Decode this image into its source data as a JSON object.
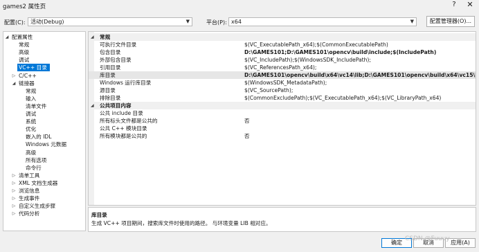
{
  "window": {
    "title": "games2 属性页",
    "help": "?",
    "close": "✕"
  },
  "toolbar": {
    "config_label": "配置(C):",
    "config_value": "活动(Debug)",
    "platform_label": "平台(P):",
    "platform_value": "x64",
    "config_manager": "配置管理器(O)..."
  },
  "tree": [
    {
      "label": "配置属性",
      "exp": "◢",
      "level": 0
    },
    {
      "label": "常规",
      "level": 1
    },
    {
      "label": "高级",
      "level": 1
    },
    {
      "label": "调试",
      "level": 1
    },
    {
      "label": "VC++ 目录",
      "level": 1,
      "selected": true
    },
    {
      "label": "C/C++",
      "exp": "▷",
      "level": 1
    },
    {
      "label": "链接器",
      "exp": "◢",
      "level": 1
    },
    {
      "label": "常规",
      "level": 2
    },
    {
      "label": "输入",
      "level": 2
    },
    {
      "label": "清单文件",
      "level": 2
    },
    {
      "label": "调试",
      "level": 2
    },
    {
      "label": "系统",
      "level": 2
    },
    {
      "label": "优化",
      "level": 2
    },
    {
      "label": "嵌入的 IDL",
      "level": 2
    },
    {
      "label": "Windows 元数据",
      "level": 2
    },
    {
      "label": "高级",
      "level": 2
    },
    {
      "label": "所有选项",
      "level": 2
    },
    {
      "label": "命令行",
      "level": 2
    },
    {
      "label": "清单工具",
      "exp": "▷",
      "level": 1
    },
    {
      "label": "XML 文档生成器",
      "exp": "▷",
      "level": 1
    },
    {
      "label": "浏览信息",
      "exp": "▷",
      "level": 1
    },
    {
      "label": "生成事件",
      "exp": "▷",
      "level": 1
    },
    {
      "label": "自定义生成步骤",
      "exp": "▷",
      "level": 1
    },
    {
      "label": "代码分析",
      "exp": "▷",
      "level": 1
    }
  ],
  "grid": [
    {
      "category": "常规",
      "exp": "◢"
    },
    {
      "name": "可执行文件目录",
      "value": "$(VC_ExecutablePath_x64);$(CommonExecutablePath)"
    },
    {
      "name": "包含目录",
      "value": "D:\\GAMES101;D:\\GAMES101\\opencv\\build\\include;$(IncludePath)",
      "bold": true
    },
    {
      "name": "外部包含目录",
      "value": "$(VC_IncludePath);$(WindowsSDK_IncludePath);"
    },
    {
      "name": "引用目录",
      "value": "$(VC_ReferencesPath_x64);"
    },
    {
      "name": "库目录",
      "value": "D:\\GAMES101\\opencv\\build\\x64\\vc14\\lib;D:\\GAMES101\\opencv\\build\\x64\\vc15\\lib;$(Li",
      "bold": true,
      "highlight": true
    },
    {
      "name": "Windows 运行库目录",
      "value": "$(WindowsSDK_MetadataPath);"
    },
    {
      "name": "源目录",
      "value": "$(VC_SourcePath);"
    },
    {
      "name": "排除目录",
      "value": "$(CommonExcludePath);$(VC_ExecutablePath_x64);$(VC_LibraryPath_x64)"
    },
    {
      "category": "公共项目内容",
      "exp": "◢"
    },
    {
      "name": "公共 include 目录",
      "value": ""
    },
    {
      "name": "所有标头文件都是公共的",
      "value": "否"
    },
    {
      "name": "公共 C++ 模块目录",
      "value": ""
    },
    {
      "name": "所有模块都是公共的",
      "value": "否"
    }
  ],
  "description": {
    "title": "库目录",
    "text": "生成 VC++ 项目期间，搜索库文件时使用的路径。 与环境变量 LIB 相对应。"
  },
  "buttons": {
    "ok": "确定",
    "cancel": "取消",
    "apply": "应用(A)"
  },
  "watermark": "CSDN @Fuuuy"
}
